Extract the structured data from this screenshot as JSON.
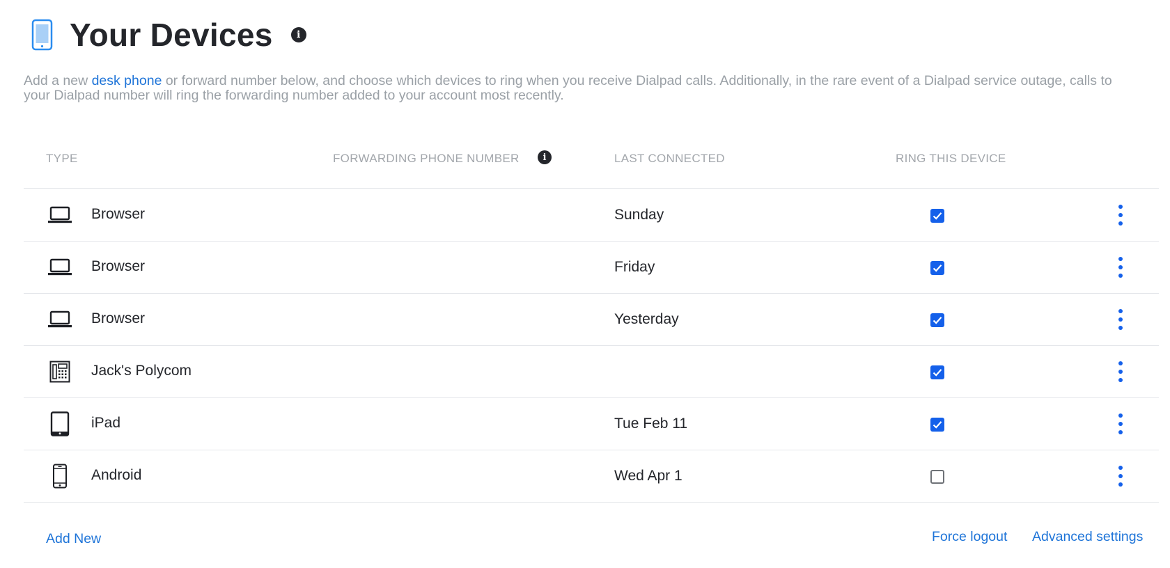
{
  "header": {
    "title": "Your Devices",
    "info_glyph": "i"
  },
  "description": {
    "before_link": "Add a new ",
    "link": "desk phone",
    "after_link": " or forward number below, and choose which devices to ring when you receive Dialpad calls. Additionally, in the rare event of a Dialpad service outage, calls to your Dialpad number will ring the forwarding number added to your account most recently."
  },
  "table": {
    "columns": {
      "type": "TYPE",
      "forwarding": "FORWARDING PHONE NUMBER",
      "last_connected": "LAST CONNECTED",
      "ring": "RING THIS DEVICE"
    },
    "rows": [
      {
        "icon": "laptop-icon",
        "type": "Browser",
        "last_connected": "Sunday",
        "ring": true
      },
      {
        "icon": "laptop-icon",
        "type": "Browser",
        "last_connected": "Friday",
        "ring": true
      },
      {
        "icon": "laptop-icon",
        "type": "Browser",
        "last_connected": "Yesterday",
        "ring": true
      },
      {
        "icon": "desk-phone-icon",
        "type": "Jack's Polycom",
        "last_connected": "",
        "ring": true
      },
      {
        "icon": "tablet-icon",
        "type": "iPad",
        "last_connected": "Tue Feb 11",
        "ring": true
      },
      {
        "icon": "mobile-phone-icon",
        "type": "Android",
        "last_connected": "Wed Apr 1",
        "ring": false
      }
    ]
  },
  "footer": {
    "add_new": "Add New",
    "force_logout": "Force logout",
    "advanced_settings": "Advanced settings"
  },
  "colors": {
    "accent": "#1460ea",
    "link": "#1e74d8",
    "muted_text": "#9aa0a6",
    "header_icon": "#2b8def"
  }
}
